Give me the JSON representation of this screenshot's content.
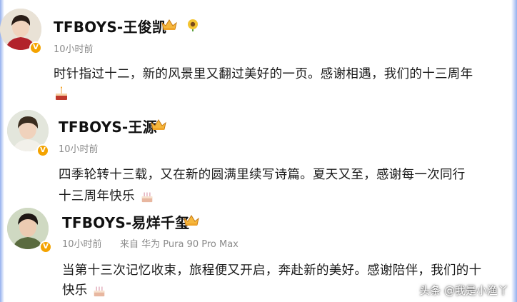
{
  "posts": [
    {
      "author": "TFBOYS-王俊凯",
      "time": "10小时前",
      "device": "",
      "line1": "时针指过十二，新的风景里又翻过美好的一页。感谢相遇，我们的十三周年",
      "line2": ""
    },
    {
      "author": "TFBOYS-王源",
      "time": "10小时前",
      "device": "",
      "line1": "四季轮转十三载，又在新的圆满里续写诗篇。夏天又至，感谢每一次同行",
      "line2": "十三周年快乐"
    },
    {
      "author": "TFBOYS-易烊千玺",
      "time": "10小时前",
      "device": "来自 华为 Pura 90 Pro Max",
      "line1": "当第十三次记忆收束，旅程便又开启，奔赴新的美好。感谢陪伴，我们的十",
      "line2": "快乐"
    }
  ],
  "verified_badge": "V",
  "watermark": "头条 @我是小渔丫",
  "colors": {
    "badge": "#f4a300",
    "name": "#111111",
    "meta": "#8a8a8a",
    "text": "#1a1a1a"
  },
  "icons": [
    "crown-member-icon",
    "sunflower-icon",
    "cake-icon",
    "verified-badge-icon"
  ]
}
